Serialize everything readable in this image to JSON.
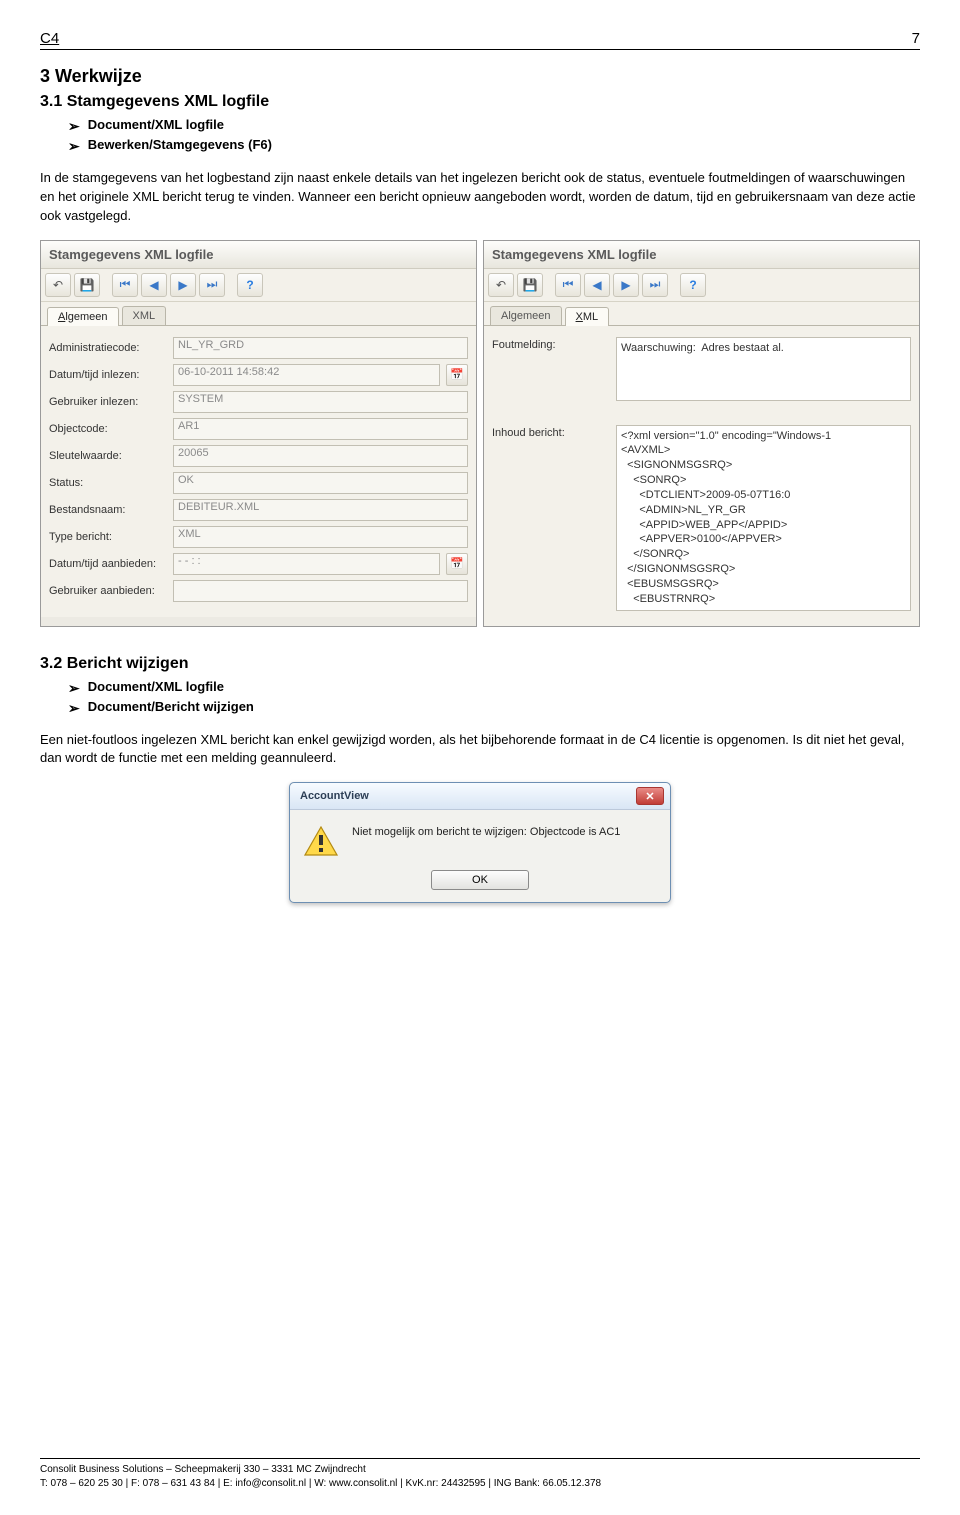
{
  "header": {
    "left": "C4",
    "right": "7"
  },
  "s3": {
    "title": "3  Werkwijze",
    "sub31": "3.1 Stamgegevens XML logfile",
    "bullets31": [
      "Document/XML logfile",
      "Bewerken/Stamgegevens (F6)"
    ],
    "para31": "In de stamgegevens van het logbestand zijn naast enkele details van het ingelezen bericht ook de status, eventuele foutmeldingen of waarschuwingen en het originele XML bericht terug te vinden. Wanneer een bericht opnieuw aangeboden wordt, worden de datum, tijd en gebruikersnaam van deze actie ook vastgelegd.",
    "sub32": "3.2  Bericht wijzigen",
    "bullets32": [
      "Document/XML logfile",
      "Document/Bericht wijzigen"
    ],
    "para32": "Een niet-foutloos ingelezen XML bericht kan enkel gewijzigd worden, als het bijbehorende formaat in de C4 licentie is opgenomen. Is dit niet het geval, dan wordt de functie met een melding geannuleerd."
  },
  "winA": {
    "title": "Stamgegevens XML logfile",
    "tabs": {
      "algemeen_pre": "A",
      "algemeen": "lgemeen",
      "xml": "XML"
    },
    "fields": {
      "admin_l": "Administratiecode:",
      "admin_v": "NL_YR_GRD",
      "datum_l": "Datum/tijd inlezen:",
      "datum_v": "06-10-2011 14:58:42",
      "gebr_l": "Gebruiker inlezen:",
      "gebr_v": "SYSTEM",
      "obj_l": "Objectcode:",
      "obj_v": "AR1",
      "sleutel_l": "Sleutelwaarde:",
      "sleutel_v": "20065",
      "status_l": "Status:",
      "status_v": "OK",
      "bestand_l": "Bestandsnaam:",
      "bestand_v": "DEBITEUR.XML",
      "type_l": "Type bericht:",
      "type_v": "XML",
      "aanb_l": "Datum/tijd aanbieden:",
      "aanb_v": "- -        :  :",
      "gebra_l": "Gebruiker aanbieden:",
      "gebra_v": ""
    }
  },
  "winB": {
    "title": "Stamgegevens XML logfile",
    "tabs": {
      "algemeen": "Algemeen",
      "xml_pre": "X",
      "xml": "ML"
    },
    "fout_l": "Foutmelding:",
    "fout_v": "Waarschuwing:  Adres bestaat al.",
    "inhoud_l": "Inhoud bericht:",
    "inhoud_v": "<?xml version=\"1.0\" encoding=\"Windows-1\n<AVXML>\n  <SIGNONMSGSRQ>\n    <SONRQ>\n      <DTCLIENT>2009-05-07T16:0\n      <ADMIN>NL_YR_GR\n      <APPID>WEB_APP</APPID>\n      <APPVER>0100</APPVER>\n    </SONRQ>\n  </SIGNONMSGSRQ>\n  <EBUSMSGSRQ>\n    <EBUSTRNRQ>"
  },
  "dialog": {
    "title": "AccountView",
    "msg": "Niet mogelijk om bericht te wijzigen: Objectcode is AC1",
    "ok": "OK"
  },
  "footer": {
    "l1": "Consolit Business Solutions – Scheepmakerij 330 – 3331 MC Zwijndrecht",
    "l2": "T: 078 – 620 25 30 | F: 078 – 631 43 84 | E: info@consolit.nl | W: www.consolit.nl | KvK.nr: 24432595 | ING Bank: 66.05.12.378"
  }
}
